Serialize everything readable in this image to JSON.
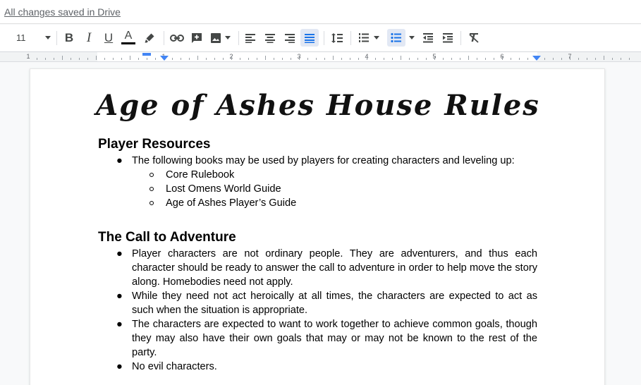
{
  "header": {
    "saved_status": "All changes saved in Drive"
  },
  "toolbar": {
    "font_size": "11"
  },
  "icons": [
    "bold-icon",
    "italic-icon",
    "underline-icon",
    "text-color-icon",
    "highlight-icon",
    "link-icon",
    "add-comment-icon",
    "image-icon",
    "align-left-icon",
    "align-center-icon",
    "align-right-icon",
    "justify-icon",
    "line-spacing-icon",
    "numbered-list-icon",
    "bulleted-list-icon",
    "decrease-indent-icon",
    "increase-indent-icon",
    "clear-formatting-icon"
  ],
  "colors": {
    "accent": "#1a73e8",
    "active_bg": "#e2e8f4",
    "ruler_marker": "#4285f4",
    "text_color_bar": "#000000"
  },
  "ruler": {
    "numbers": [
      "1",
      "1",
      "2",
      "3",
      "4",
      "5",
      "6",
      "7"
    ]
  },
  "toolbar_letters": {
    "bold": "B",
    "italic": "I",
    "underline": "U",
    "text_color": "A"
  },
  "document": {
    "title": "Age of Ashes House Rules",
    "sections": [
      {
        "heading": "Player Resources",
        "bullets": [
          {
            "text": "The following books may be used by players for creating characters and leveling up:",
            "sub": [
              "Core Rulebook",
              "Lost Omens World Guide",
              "Age of Ashes Player’s Guide"
            ]
          }
        ]
      },
      {
        "heading": "The Call to Adventure",
        "bullets": [
          {
            "text": "Player characters are not ordinary people. They are adventurers, and thus each character should be ready to answer the call to adventure in order to help move the story along. Homebodies need not apply."
          },
          {
            "text": "While they need not act heroically at all times, the characters are expected to act as such when the situation is appropriate."
          },
          {
            "text": "The characters are expected to want to work together to achieve common goals, though they may also have their own goals that may or may not be known to the rest of the party."
          },
          {
            "text": "No evil characters."
          }
        ]
      }
    ]
  },
  "bullet_glyph": "●"
}
